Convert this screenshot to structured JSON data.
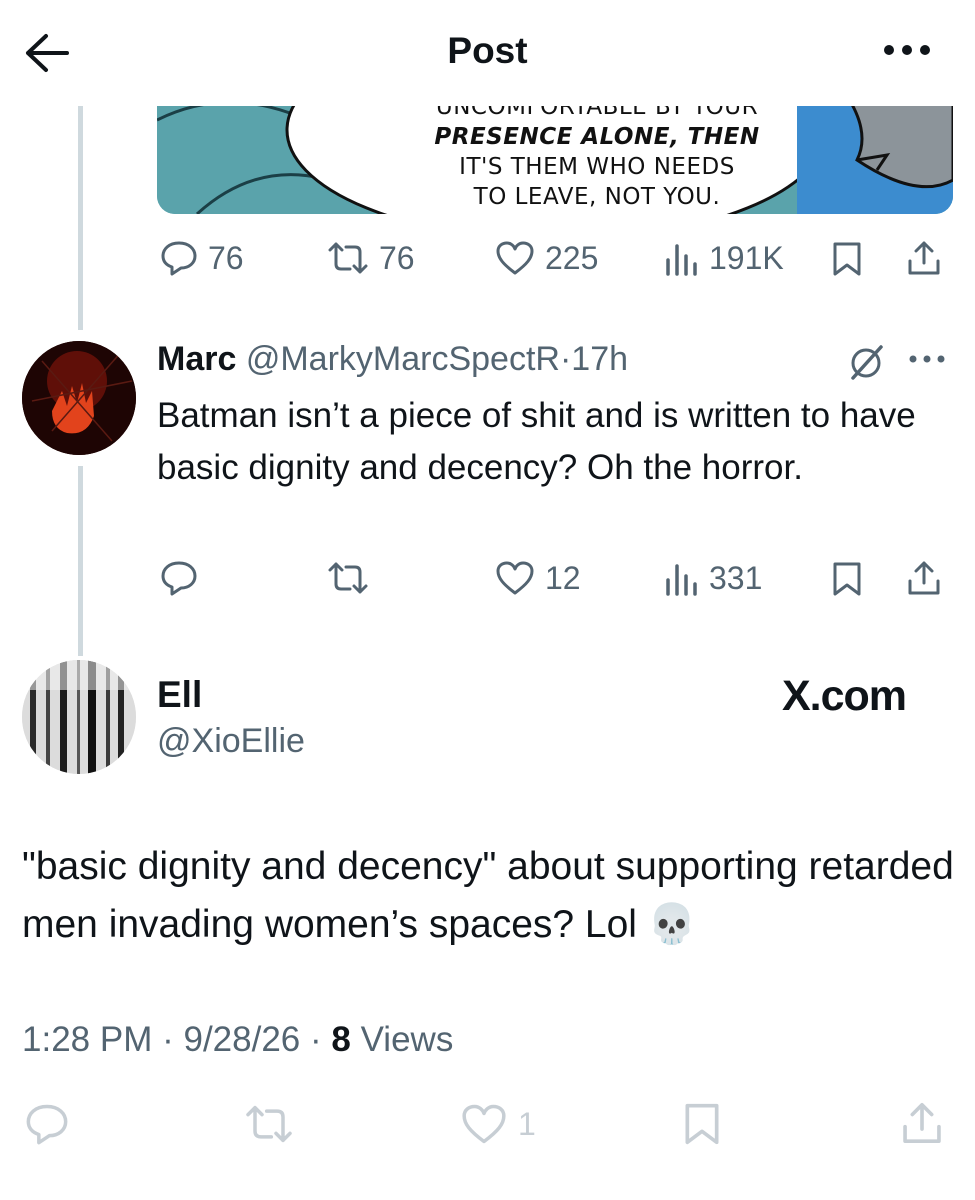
{
  "header": {
    "title": "Post"
  },
  "parent_post": {
    "comic_lines": [
      "UNCOMFORTABLE BY YOUR",
      "PRESENCE ALONE, THEN",
      "IT'S THEM WHO NEEDS",
      "TO LEAVE, NOT YOU."
    ],
    "stats": {
      "replies": "76",
      "reposts": "76",
      "likes": "225",
      "views": "191K"
    }
  },
  "reply": {
    "name": "Marc",
    "handle": "@MarkyMarcSpectR",
    "separator": "·",
    "time": "17h",
    "text": "Batman isn’t a piece of shit and is written to have basic dignity and decency? Oh the horror.",
    "stats": {
      "likes": "12",
      "views": "331"
    }
  },
  "main_post": {
    "name": "Ell",
    "handle": "@XioEllie",
    "brand": "X.com",
    "text": "\"basic dignity and decency\" about supporting retarded men invading women’s spaces? Lol 💀",
    "time": "1:28 PM",
    "separator": "·",
    "date": "9/28/26",
    "views_count": "8",
    "views_label": "Views",
    "stats": {
      "likes": "1"
    }
  },
  "colors": {
    "text": "#0f1419",
    "muted": "#536471",
    "faint": "#c7ced4",
    "thread_line": "#cfd9de"
  }
}
